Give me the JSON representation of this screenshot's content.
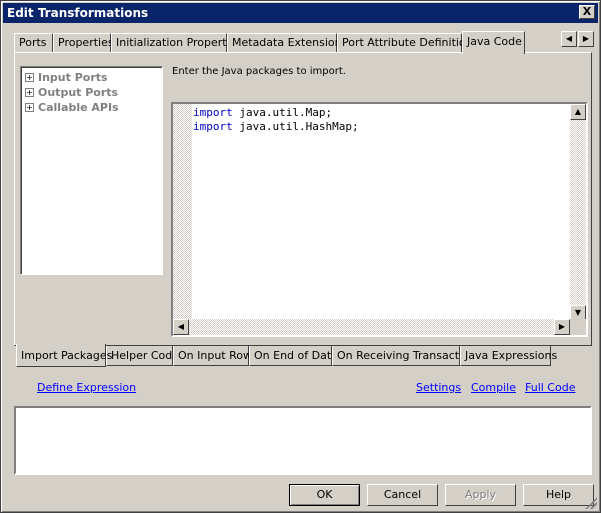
{
  "window": {
    "title": "Edit Transformations",
    "close": "X"
  },
  "tabs": [
    {
      "label": "Ports"
    },
    {
      "label": "Properties"
    },
    {
      "label": "Initialization Properties"
    },
    {
      "label": "Metadata Extensions"
    },
    {
      "label": "Port Attribute Definitions"
    },
    {
      "label": "Java Code"
    }
  ],
  "tab_scroll": {
    "left": "◀",
    "right": "▶"
  },
  "tree": [
    {
      "label": "Input Ports",
      "expander": "+"
    },
    {
      "label": "Output Ports",
      "expander": "+"
    },
    {
      "label": "Callable APIs",
      "expander": "+"
    }
  ],
  "instruction": "Enter the Java packages to import.",
  "code": [
    {
      "keyword": "import",
      "rest": " java.util.Map;"
    },
    {
      "keyword": "import",
      "rest": " java.util.HashMap;"
    }
  ],
  "scroll_glyphs": {
    "up": "▲",
    "down": "▼",
    "left": "◀",
    "right": "▶"
  },
  "bottom_tabs": [
    {
      "label": "Import Packages"
    },
    {
      "label": "Helper Code"
    },
    {
      "label": "On Input Row"
    },
    {
      "label": "On End of Data"
    },
    {
      "label": "On Receiving Transaction"
    },
    {
      "label": "Java Expressions"
    }
  ],
  "links": {
    "define_expression": "Define Expression",
    "settings": "Settings",
    "compile": "Compile",
    "full_code": "Full Code"
  },
  "buttons": {
    "ok": "OK",
    "cancel": "Cancel",
    "apply": "Apply",
    "help": "Help"
  },
  "colors": {
    "titlebar": "#0a246a",
    "keyword": "#0000c0",
    "link": "#0000ff",
    "face": "#d4d0c8"
  }
}
